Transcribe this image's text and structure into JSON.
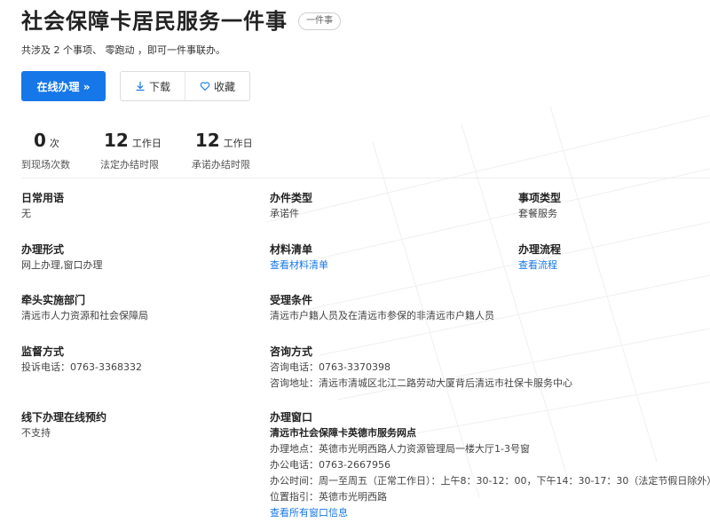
{
  "header": {
    "title": "社会保障卡居民服务一件事",
    "badge": "一件事",
    "subtitle": "共涉及 2 个事项、 零跑动 ，即可一件事联办。"
  },
  "actions": {
    "online_label": "在线办理 »",
    "download_label": "下载",
    "favorite_label": "收藏"
  },
  "stats": [
    {
      "value": "0",
      "unit": "次",
      "label": "到现场次数"
    },
    {
      "value": "12",
      "unit": "工作日",
      "label": "法定办结时限"
    },
    {
      "value": "12",
      "unit": "工作日",
      "label": "承诺办结时限"
    }
  ],
  "fields": {
    "daily_terms": {
      "label": "日常用语",
      "value": "无"
    },
    "case_type": {
      "label": "办件类型",
      "value": "承诺件"
    },
    "item_type": {
      "label": "事项类型",
      "value": "套餐服务"
    },
    "handling_form": {
      "label": "办理形式",
      "value": "网上办理,窗口办理"
    },
    "materials": {
      "label": "材料清单",
      "link": "查看材料清单"
    },
    "process": {
      "label": "办理流程",
      "link": "查看流程"
    },
    "lead_dept": {
      "label": "牵头实施部门",
      "value": "清远市人力资源和社会保障局"
    },
    "conditions": {
      "label": "受理条件",
      "value": "清远市户籍人员及在清远市参保的非清远市户籍人员"
    },
    "supervision": {
      "label": "监督方式",
      "value": "投诉电话：0763-3368332"
    },
    "consult": {
      "label": "咨询方式",
      "phone": "咨询电话：0763-3370398",
      "address": "咨询地址：清远市清城区北江二路劳动大厦背后清远市社保卡服务中心"
    },
    "offline_booking": {
      "label": "线下办理在线预约",
      "value": "不支持"
    },
    "window": {
      "label": "办理窗口",
      "name": "清远市社会保障卡英德市服务网点",
      "address": "办理地点：英德市光明西路人力资源管理局一楼大厅1-3号窗",
      "phone": "办公电话：0763-2667956",
      "hours": "办公时间：周一至周五（正常工作日）：上午8：30-12：00，下午14：30-17：30（法定节假日除外）",
      "location": "位置指引：英德市光明西路",
      "link": "查看所有窗口信息"
    }
  },
  "colors": {
    "accent": "#1677e8",
    "text": "#333333"
  }
}
